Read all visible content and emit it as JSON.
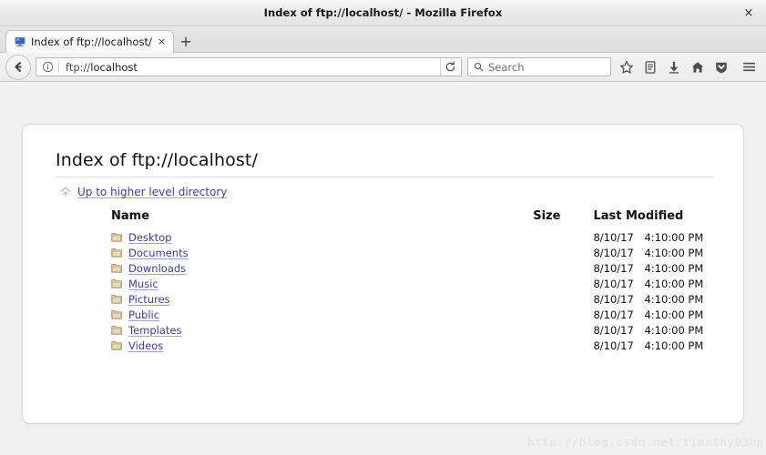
{
  "window": {
    "title": "Index of ftp://localhost/ - Mozilla Firefox",
    "close_label": "×"
  },
  "tabs": {
    "items": [
      {
        "title": "Index of ftp://localhost/",
        "favicon": "computer-icon",
        "close_label": "×"
      }
    ],
    "new_tab_label": "+"
  },
  "toolbar": {
    "back_icon": "back-arrow-icon",
    "identity_icon": "info-icon",
    "url_scheme": "ftp://",
    "url_host": "localhost",
    "url_full": "ftp://localhost",
    "reload_icon": "reload-icon",
    "search_icon": "search-icon",
    "search_placeholder": "Search",
    "search_value": "",
    "icons": [
      {
        "name": "bookmark-star-icon",
        "label": "Bookmark this page"
      },
      {
        "name": "library-icon",
        "label": "Show your library"
      },
      {
        "name": "download-icon",
        "label": "Downloads"
      },
      {
        "name": "home-icon",
        "label": "Home"
      },
      {
        "name": "pocket-shield-icon",
        "label": "Save to Pocket"
      },
      {
        "name": "hamburger-menu-icon",
        "label": "Open menu"
      }
    ]
  },
  "page": {
    "heading": "Index of ftp://localhost/",
    "up_link": "Up to higher level directory",
    "up_icon": "arrow-up-icon",
    "columns": {
      "name": "Name",
      "size": "Size",
      "modified": "Last Modified"
    },
    "rows": [
      {
        "icon": "folder-icon",
        "name": "Desktop",
        "size": "",
        "date": "8/10/17",
        "time": "4:10:00 PM"
      },
      {
        "icon": "folder-icon",
        "name": "Documents",
        "size": "",
        "date": "8/10/17",
        "time": "4:10:00 PM"
      },
      {
        "icon": "folder-icon",
        "name": "Downloads",
        "size": "",
        "date": "8/10/17",
        "time": "4:10:00 PM"
      },
      {
        "icon": "folder-icon",
        "name": "Music",
        "size": "",
        "date": "8/10/17",
        "time": "4:10:00 PM"
      },
      {
        "icon": "folder-icon",
        "name": "Pictures",
        "size": "",
        "date": "8/10/17",
        "time": "4:10:00 PM"
      },
      {
        "icon": "folder-icon",
        "name": "Public",
        "size": "",
        "date": "8/10/17",
        "time": "4:10:00 PM"
      },
      {
        "icon": "folder-icon",
        "name": "Templates",
        "size": "",
        "date": "8/10/17",
        "time": "4:10:00 PM"
      },
      {
        "icon": "folder-icon",
        "name": "Videos",
        "size": "",
        "date": "8/10/17",
        "time": "4:10:00 PM"
      }
    ]
  },
  "watermark": "http://blog.csdn.net/timothy93bp",
  "colors": {
    "link": "#3b3bb5",
    "page_bg": "#f1f1f1",
    "card_bg": "#ffffff",
    "chrome_bg": "#ececec",
    "folder": "#d9c79b"
  }
}
